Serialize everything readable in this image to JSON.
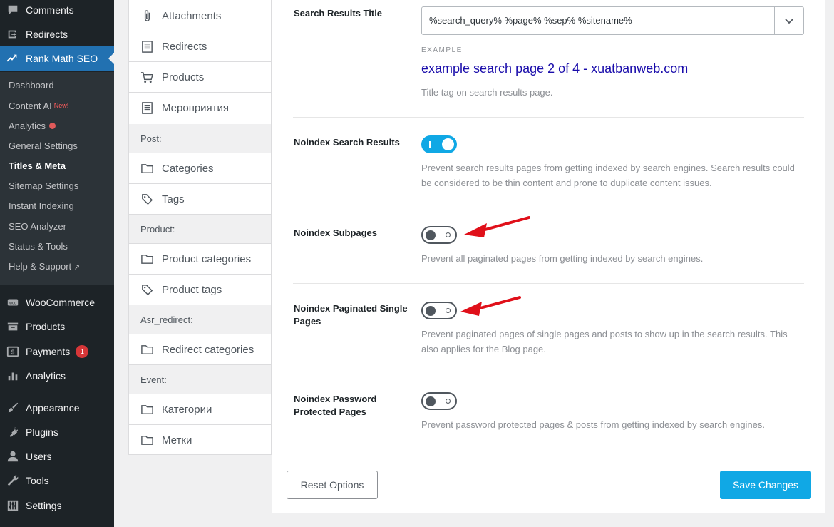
{
  "wp_menu": {
    "comments": "Comments",
    "redirects": "Redirects",
    "rank_math": "Rank Math SEO",
    "woocommerce": "WooCommerce",
    "products": "Products",
    "payments": "Payments",
    "payments_count": "1",
    "analytics": "Analytics",
    "appearance": "Appearance",
    "plugins": "Plugins",
    "users": "Users",
    "tools": "Tools",
    "settings": "Settings"
  },
  "rank_math_submenu": {
    "dashboard": "Dashboard",
    "content_ai": "Content AI",
    "content_ai_badge": "New!",
    "analytics": "Analytics",
    "general_settings": "General Settings",
    "titles_meta": "Titles & Meta",
    "sitemap_settings": "Sitemap Settings",
    "instant_indexing": "Instant Indexing",
    "seo_analyzer": "SEO Analyzer",
    "status_tools": "Status & Tools",
    "help_support": "Help & Support"
  },
  "settings_nav": {
    "attachments": "Attachments",
    "redirects": "Redirects",
    "products": "Products",
    "events_ru": "Мероприятия",
    "post_header": "Post:",
    "categories": "Categories",
    "tags": "Tags",
    "product_header": "Product:",
    "product_categories": "Product categories",
    "product_tags": "Product tags",
    "asr_header": "Asr_redirect:",
    "redirect_categories": "Redirect categories",
    "event_header": "Event:",
    "categories_ru": "Категории",
    "tags_ru": "Метки"
  },
  "settings": {
    "search_title": {
      "label": "Search Results Title",
      "value": "%search_query% %page% %sep% %sitename%",
      "example_label": "EXAMPLE",
      "example_value": "example search page 2 of 4 - xuatbanweb.com",
      "description": "Title tag on search results page."
    },
    "noindex_search": {
      "label": "Noindex Search Results",
      "enabled": true,
      "description": "Prevent search results pages from getting indexed by search engines. Search results could be considered to be thin content and prone to duplicate content issues."
    },
    "noindex_subpages": {
      "label": "Noindex Subpages",
      "enabled": false,
      "description": "Prevent all paginated pages from getting indexed by search engines."
    },
    "noindex_paginated": {
      "label": "Noindex Paginated Single Pages",
      "enabled": false,
      "description": "Prevent paginated pages of single pages and posts to show up in the search results. This also applies for the Blog page."
    },
    "noindex_password": {
      "label": "Noindex Password Protected Pages",
      "enabled": false,
      "description": "Prevent password protected pages & posts from getting indexed by search engines."
    }
  },
  "footer": {
    "reset": "Reset Options",
    "save": "Save Changes"
  },
  "colors": {
    "accent": "#10a8e5",
    "wp_active": "#2271b1",
    "annotation_arrow": "#e0101a"
  }
}
